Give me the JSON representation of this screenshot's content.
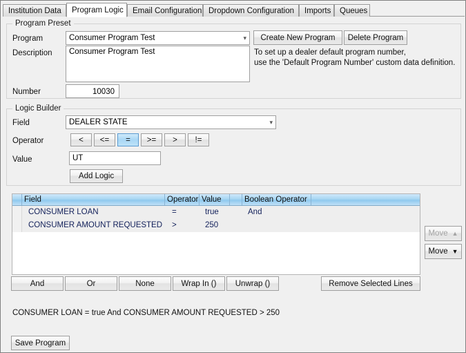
{
  "window": {
    "title": "Program Logic"
  },
  "tabs": [
    {
      "label": "Institution Data",
      "active": false
    },
    {
      "label": "Program Logic",
      "active": true
    },
    {
      "label": "Email Configuration",
      "active": false
    },
    {
      "label": "Dropdown Configuration",
      "active": false
    },
    {
      "label": "Imports",
      "active": false
    },
    {
      "label": "Queues",
      "active": false
    }
  ],
  "program_preset": {
    "group_label": "Program Preset",
    "program_label": "Program",
    "program_value": "Consumer Program Test",
    "description_label": "Description",
    "description_value": "Consumer Program Test",
    "number_label": "Number",
    "number_value": "10030",
    "create_button": "Create New Program",
    "delete_button": "Delete Program",
    "info_text": "To set up a dealer default program number,\nuse the 'Default Program Number' custom data definition."
  },
  "logic_builder": {
    "group_label": "Logic Builder",
    "field_label": "Field",
    "field_value": "DEALER STATE",
    "operator_label": "Operator",
    "operators": [
      {
        "label": "<",
        "selected": false
      },
      {
        "label": "<=",
        "selected": false
      },
      {
        "label": "=",
        "selected": true
      },
      {
        "label": ">=",
        "selected": false
      },
      {
        "label": ">",
        "selected": false
      },
      {
        "label": "!=",
        "selected": false
      }
    ],
    "value_label": "Value",
    "value_value": "UT",
    "add_logic_button": "Add Logic"
  },
  "grid": {
    "columns": [
      "Field",
      "Operator",
      "Value",
      "",
      "Boolean Operator",
      ""
    ],
    "rows": [
      {
        "field": "CONSUMER LOAN",
        "operator": "=",
        "value": "true",
        "blank": "",
        "boolean_operator": "And"
      },
      {
        "field": "CONSUMER AMOUNT REQUESTED",
        "operator": ">",
        "value": "250",
        "blank": "",
        "boolean_operator": ""
      }
    ]
  },
  "move_buttons": {
    "up_label": "Move",
    "up_icon": "triangle-up-icon",
    "up_glyph": "▲",
    "up_disabled": true,
    "down_label": "Move",
    "down_icon": "triangle-down-icon",
    "down_glyph": "▼",
    "down_disabled": false
  },
  "action_buttons": {
    "and": "And",
    "or": "Or",
    "none": "None",
    "wrap_in": "Wrap In ()",
    "unwrap": "Unwrap ()",
    "remove_selected_lines": "Remove Selected Lines"
  },
  "summary_text": "CONSUMER LOAN = true  And  CONSUMER AMOUNT REQUESTED > 250",
  "save_button": "Save Program",
  "colors": {
    "window_bg": "#f0f0f0",
    "accent_selected": "#a9d7f5",
    "grid_header": "#a8d6f2",
    "grid_text": "#12205a",
    "border": "#9e9e9e"
  }
}
